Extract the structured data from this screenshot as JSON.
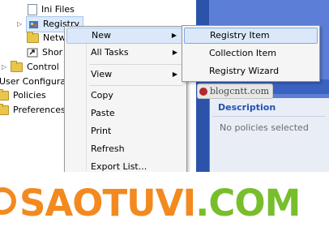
{
  "tree": {
    "items": [
      {
        "label": "Ini Files",
        "icon": "document-icon"
      },
      {
        "label": "Registry",
        "icon": "registry-icon"
      },
      {
        "label": "Netw",
        "icon": "folder-icon"
      },
      {
        "label": "Shor",
        "icon": "shortcut-icon"
      },
      {
        "label": "Control",
        "icon": "folder-icon"
      },
      {
        "label": "User Configura",
        "icon": ""
      },
      {
        "label": "Policies",
        "icon": "folder-icon"
      },
      {
        "label": "Preferences",
        "icon": "folder-icon"
      }
    ]
  },
  "context_menu": {
    "items": [
      {
        "label": "New",
        "has_submenu": true,
        "highlighted": true
      },
      {
        "label": "All Tasks",
        "has_submenu": true
      },
      {
        "label": "View",
        "has_submenu": true
      },
      {
        "label": "Copy"
      },
      {
        "label": "Paste"
      },
      {
        "label": "Print"
      },
      {
        "label": "Refresh"
      },
      {
        "label": "Export List..."
      }
    ]
  },
  "submenu": {
    "items": [
      {
        "label": "Registry Item",
        "highlighted": true
      },
      {
        "label": "Collection Item"
      },
      {
        "label": "Registry Wizard"
      }
    ]
  },
  "description": {
    "heading": "Description",
    "text": "No policies selected"
  },
  "watermark": {
    "text": "blogcntt.com"
  },
  "banner": {
    "part1": "SAOTUVI",
    "part2": ".COM",
    "colors": {
      "orange": "#f28a1f",
      "green": "#78be2c"
    }
  },
  "colors": {
    "pane_dark": "#2b53a9",
    "pane_light": "#5d7ed6",
    "highlight": "#dbe8f9"
  }
}
